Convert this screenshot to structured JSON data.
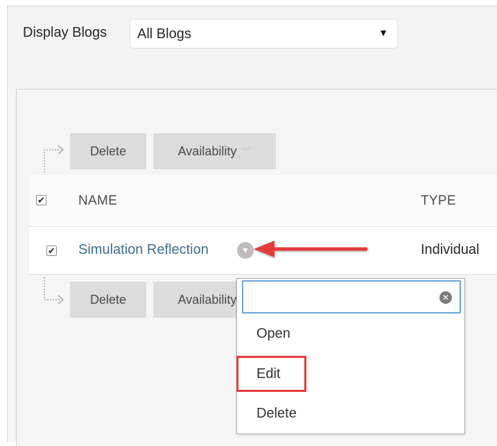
{
  "filter": {
    "label": "Display Blogs",
    "selected": "All Blogs",
    "arrow": "▼"
  },
  "toolbar": {
    "delete_label": "Delete",
    "availability_label": "Availability"
  },
  "table": {
    "headers": {
      "name": "NAME",
      "type": "TYPE"
    },
    "rows": [
      {
        "name": "Simulation Reflection",
        "type": "Individual",
        "checked": true
      }
    ]
  },
  "context_menu": {
    "search_value": "",
    "items": [
      "Open",
      "Edit",
      "Delete"
    ]
  },
  "icons": {
    "checkbox_checked": "checkmark-icon",
    "clear": "clear-circle-icon",
    "menu_toggle": "chevron-down-circle-icon",
    "availability_chevron": "double-chevron-down-icon",
    "annotation": "red-arrow-icon"
  },
  "colors": {
    "link": "#3a6f8f",
    "highlight": "#e53b3b",
    "focus": "#6aa5d8"
  }
}
